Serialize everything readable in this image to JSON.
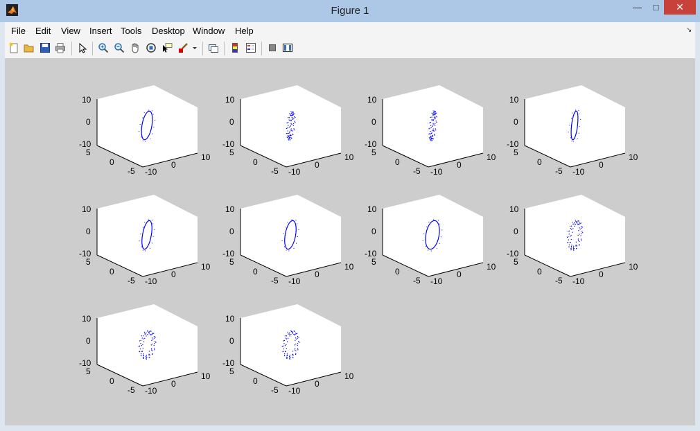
{
  "window": {
    "title": "Figure 1",
    "minimize_glyph": "—",
    "maximize_glyph": "□",
    "close_glyph": "✕"
  },
  "menubar": {
    "items": [
      "File",
      "Edit",
      "View",
      "Insert",
      "Tools",
      "Desktop",
      "Window",
      "Help"
    ],
    "overflow_glyph": "↘"
  },
  "toolbar": {
    "icons": [
      "new-figure-icon",
      "open-file-icon",
      "save-icon",
      "print-icon",
      "pointer-icon",
      "zoom-in-icon",
      "zoom-out-icon",
      "pan-hand-icon",
      "rotate-3d-icon",
      "data-cursor-icon",
      "brush-icon",
      "brush-dropdown-icon",
      "link-plot-icon",
      "insert-colorbar-icon",
      "insert-legend-icon",
      "hide-plot-tools-icon",
      "show-plot-tools-icon"
    ]
  },
  "colors": {
    "titlebar": "#adc8e6",
    "figure_background": "#cdcdcd",
    "axes_background": "#ffffff",
    "data_color": "#0000ff",
    "close_button": "#c7423a"
  },
  "chart_data": {
    "type": "scatter",
    "plot_style": "3d",
    "count": 10,
    "grid": "3 rows by 4 columns",
    "z_ticks": [
      "10",
      "0",
      "-10"
    ],
    "y_ticks": [
      "5",
      "0",
      "-5"
    ],
    "x_ticks": [
      "-10",
      "0",
      "10"
    ],
    "zlim": [
      -10,
      10
    ],
    "ylim": [
      -5,
      5
    ],
    "xlim": [
      -10,
      10
    ],
    "subplots": [
      {
        "index": 1,
        "style": "solid-ring",
        "ring_width": 0.7,
        "ring_height": 1.0
      },
      {
        "index": 2,
        "style": "dotted-ring",
        "ring_width": 0.35,
        "ring_height": 0.95
      },
      {
        "index": 3,
        "style": "dotted-line",
        "ring_width": 0.25,
        "ring_height": 1.0
      },
      {
        "index": 4,
        "style": "solid-line",
        "ring_width": 0.35,
        "ring_height": 1.0
      },
      {
        "index": 5,
        "style": "solid-ring",
        "ring_width": 0.6,
        "ring_height": 1.0
      },
      {
        "index": 6,
        "style": "solid-ring",
        "ring_width": 0.75,
        "ring_height": 1.0
      },
      {
        "index": 7,
        "style": "solid-ring",
        "ring_width": 1.0,
        "ring_height": 1.0
      },
      {
        "index": 8,
        "style": "dotted-ring",
        "ring_width": 0.95,
        "ring_height": 1.0
      },
      {
        "index": 9,
        "style": "dotted-ring",
        "ring_width": 1.1,
        "ring_height": 0.95
      },
      {
        "index": 10,
        "style": "dotted-ring",
        "ring_width": 1.1,
        "ring_height": 0.95
      }
    ]
  }
}
